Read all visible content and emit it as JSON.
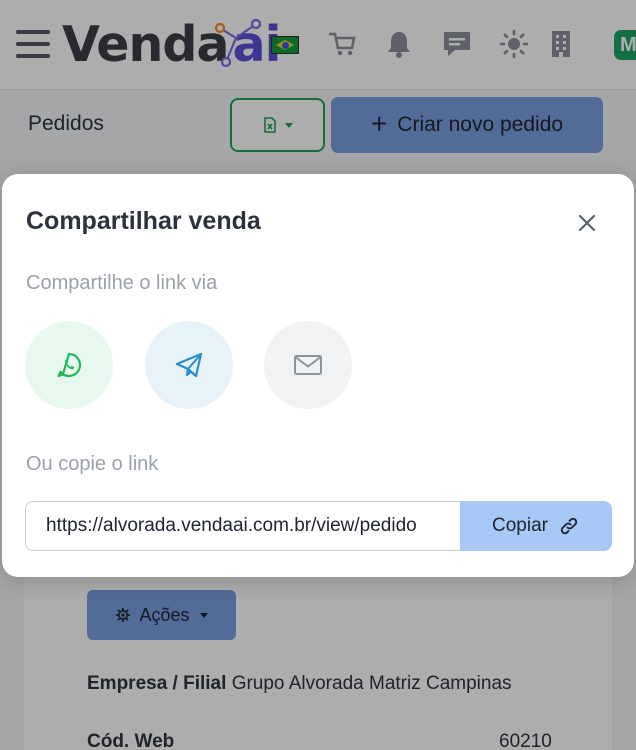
{
  "header": {
    "logo_text": "Venda",
    "logo_ai": "ai",
    "avatar_initial": "M"
  },
  "page": {
    "title": "Pedidos",
    "create_button": "Criar novo pedido"
  },
  "card": {
    "actions_button": "Ações",
    "company_label": "Empresa / Filial",
    "company_value": "Grupo Alvorada Matriz Campinas",
    "webcode_label": "Cód. Web",
    "webcode_value": "60210"
  },
  "modal": {
    "title": "Compartilhar venda",
    "share_label": "Compartilhe o link via",
    "copy_label": "Ou copie o link",
    "link_value": "https://alvorada.vendaai.com.br/view/pedido",
    "copy_button": "Copiar"
  },
  "colors": {
    "primary_button": "#7b9ee0",
    "copy_button": "#a8c8f5",
    "whatsapp": "#1fb95b",
    "telegram": "#2a8ec9",
    "excel": "#21a35b"
  },
  "icons": [
    "menu-icon",
    "cart-icon",
    "bell-icon",
    "chat-icon",
    "sun-icon",
    "building-icon",
    "excel-icon",
    "whatsapp-icon",
    "telegram-icon",
    "email-icon",
    "close-icon",
    "link-icon",
    "gear-icon"
  ]
}
